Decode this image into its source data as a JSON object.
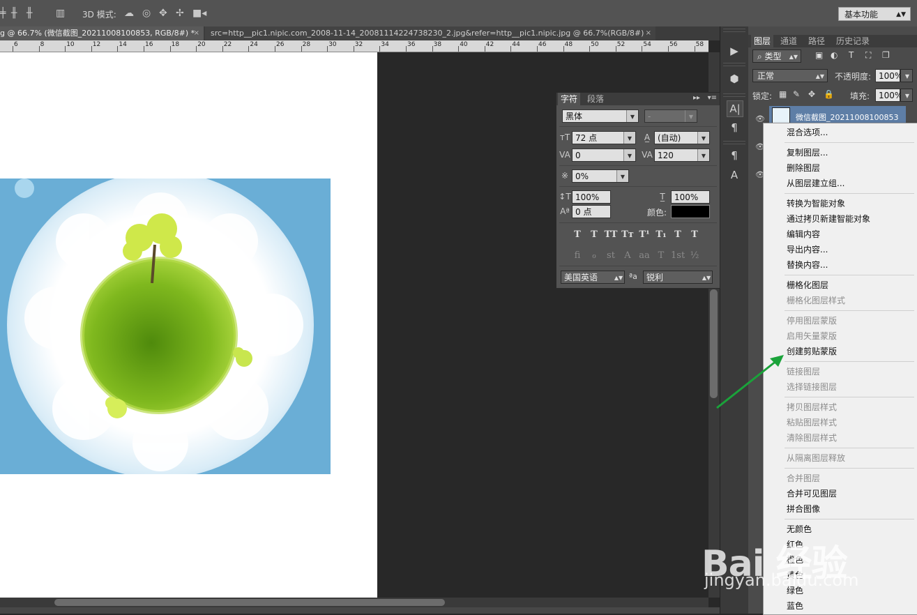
{
  "options_bar": {
    "mode_3d_label": "3D 模式:",
    "workspace_label": "基本功能",
    "icons": [
      "align-center-icon",
      "distribute-icon",
      "distribute-icon",
      "auto-align-icon",
      "orbit-3d-icon",
      "roll-3d-icon",
      "pan-3d-icon",
      "slide-3d-icon",
      "scale-3d-icon"
    ]
  },
  "document_tabs": [
    {
      "label": "g @ 66.7% (微信截图_20211008100853, RGB/8#) *",
      "close": "×"
    },
    {
      "label": "src=http__pic1.nipic.com_2008-11-14_20081114224738230_2.jpg&refer=http__pic1.nipic.jpg @ 66.7%(RGB/8#)",
      "close": "×"
    }
  ],
  "ruler": {
    "labels": [
      "6",
      "8",
      "10",
      "12",
      "14",
      "16",
      "18",
      "20",
      "22",
      "24",
      "26",
      "28",
      "30",
      "32",
      "34",
      "36",
      "38",
      "40",
      "42",
      "44",
      "46",
      "48",
      "50",
      "52",
      "54",
      "56",
      "58"
    ]
  },
  "character_panel": {
    "tabs": [
      "字符",
      "段落"
    ],
    "font_family": "黑体",
    "font_style": "-",
    "font_size": "72 点",
    "leading": "(自动)",
    "kerning": "0",
    "tracking": "120",
    "tsume": "0%",
    "vertical_scale": "100%",
    "horizontal_scale": "100%",
    "baseline_shift": "0 点",
    "color_label": "颜色:",
    "color_value": "#000000",
    "style_buttons": [
      "T",
      "T",
      "TT",
      "Tт",
      "T¹",
      "T₁",
      "T",
      "T"
    ],
    "opentype_buttons": [
      "ﬁ",
      "ℴ",
      "st",
      "A",
      "aa",
      "T",
      "1st",
      "½"
    ],
    "language": "美国英语",
    "aa_label": "ªa",
    "antialias": "锐利"
  },
  "layers_panel": {
    "tabs": [
      "图层",
      "通道",
      "路径",
      "历史记录"
    ],
    "filter_kind": "类型",
    "blend_mode": "正常",
    "opacity_label": "不透明度:",
    "opacity_value": "100%",
    "lock_label": "锁定:",
    "fill_label": "填充:",
    "fill_value": "100%",
    "layer_name": "微信截图_20211008100853"
  },
  "context_menu": {
    "groups": [
      [
        {
          "label": "混合选项...",
          "enabled": true
        }
      ],
      [
        {
          "label": "复制图层...",
          "enabled": true
        },
        {
          "label": "删除图层",
          "enabled": true
        },
        {
          "label": "从图层建立组...",
          "enabled": true
        }
      ],
      [
        {
          "label": "转换为智能对象",
          "enabled": true
        },
        {
          "label": "通过拷贝新建智能对象",
          "enabled": true
        },
        {
          "label": "编辑内容",
          "enabled": true
        },
        {
          "label": "导出内容...",
          "enabled": true
        },
        {
          "label": "替换内容...",
          "enabled": true
        }
      ],
      [
        {
          "label": "栅格化图层",
          "enabled": true
        },
        {
          "label": "栅格化图层样式",
          "enabled": false
        }
      ],
      [
        {
          "label": "停用图层蒙版",
          "enabled": false
        },
        {
          "label": "启用矢量蒙版",
          "enabled": false
        },
        {
          "label": "创建剪贴蒙版",
          "enabled": true
        }
      ],
      [
        {
          "label": "链接图层",
          "enabled": false
        },
        {
          "label": "选择链接图层",
          "enabled": false
        }
      ],
      [
        {
          "label": "拷贝图层样式",
          "enabled": false
        },
        {
          "label": "粘贴图层样式",
          "enabled": false
        },
        {
          "label": "清除图层样式",
          "enabled": false
        }
      ],
      [
        {
          "label": "从隔离图层释放",
          "enabled": false
        }
      ],
      [
        {
          "label": "合并图层",
          "enabled": false
        },
        {
          "label": "合并可见图层",
          "enabled": true
        },
        {
          "label": "拼合图像",
          "enabled": true
        }
      ],
      [
        {
          "label": "无颜色",
          "enabled": true
        },
        {
          "label": "红色",
          "enabled": true
        },
        {
          "label": "橙色",
          "enabled": true
        },
        {
          "label": "黄色",
          "enabled": true
        },
        {
          "label": "绿色",
          "enabled": true
        },
        {
          "label": "蓝色",
          "enabled": true
        }
      ]
    ]
  },
  "watermark": {
    "text": "Bai 经验",
    "sub": "jingyan.baidu.com"
  },
  "colors": {
    "annotation_arrow": "#1aa33a",
    "selected_layer": "#5e7ea6",
    "sky": "#6fb0d8",
    "grass": "#7bb51c"
  }
}
